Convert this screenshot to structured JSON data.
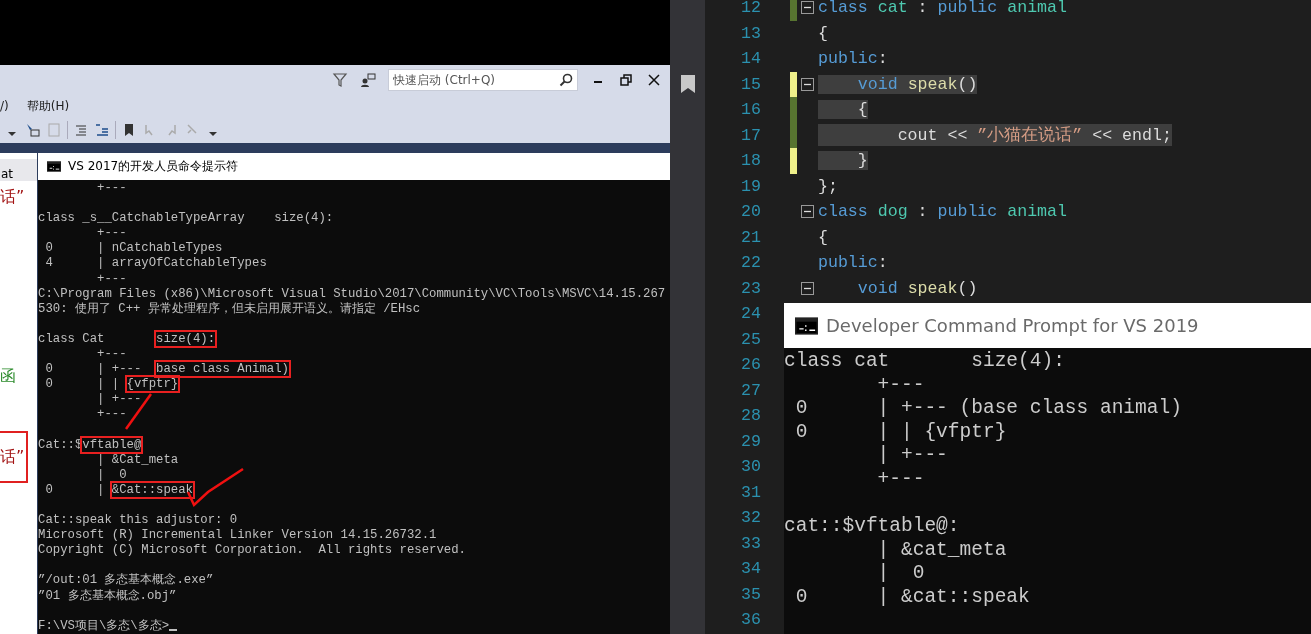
{
  "ide_window": {
    "quick_launch": {
      "placeholder": "快速启动 (Ctrl+Q)"
    },
    "menu": [
      {
        "label": "/)"
      },
      {
        "label": "帮助(H)"
      }
    ]
  },
  "background_editor": {
    "fragments": [
      {
        "text": "at",
        "kind": "tab"
      },
      {
        "text": "话”",
        "kind": "string"
      },
      {
        "text": "函",
        "kind": "comment"
      },
      {
        "text": "话”",
        "kind": "boxed"
      }
    ]
  },
  "console_2017": {
    "title": "VS 2017的开发人员命令提示符",
    "lines": [
      {
        "kind": "text",
        "text": "        +---"
      },
      {
        "kind": "blank"
      },
      {
        "kind": "text",
        "text": "class _s__CatchableTypeArray    size(4):"
      },
      {
        "kind": "text",
        "text": "        +---"
      },
      {
        "kind": "text",
        "text": " 0      | nCatchableTypes"
      },
      {
        "kind": "text",
        "text": " 4      | arrayOfCatchableTypes"
      },
      {
        "kind": "text",
        "text": "        +---"
      },
      {
        "kind": "text",
        "text": "C:\\Program Files (x86)\\Microsoft Visual Studio\\2017\\Community\\VC\\Tools\\MSVC\\14.15.267"
      },
      {
        "kind": "text",
        "text": "530: 使用了 C++ 异常处理程序，但未启用展开语义。请指定 /EHsc"
      },
      {
        "kind": "blank"
      },
      {
        "kind": "marked",
        "segments": [
          {
            "text": "class Cat       ",
            "boxed": false
          },
          {
            "text": "size(4):",
            "boxed": true
          }
        ]
      },
      {
        "kind": "text",
        "text": "        +---"
      },
      {
        "kind": "marked",
        "segments": [
          {
            "text": " 0      | +---  ",
            "boxed": false
          },
          {
            "text": "base class Animal)",
            "boxed": true
          }
        ]
      },
      {
        "kind": "marked",
        "segments": [
          {
            "text": " 0      | | ",
            "boxed": false
          },
          {
            "text": "{vfptr}",
            "boxed": true
          }
        ]
      },
      {
        "kind": "text",
        "text": "        | +---"
      },
      {
        "kind": "text",
        "text": "        +---"
      },
      {
        "kind": "blank"
      },
      {
        "kind": "marked",
        "segments": [
          {
            "text": "Cat::$",
            "boxed": false
          },
          {
            "text": "vftable@",
            "boxed": true
          }
        ]
      },
      {
        "kind": "text",
        "text": "        | &Cat_meta"
      },
      {
        "kind": "text",
        "text": "        |  0"
      },
      {
        "kind": "marked",
        "segments": [
          {
            "text": " 0      | ",
            "boxed": false
          },
          {
            "text": "&Cat::speak",
            "boxed": true
          }
        ]
      },
      {
        "kind": "blank"
      },
      {
        "kind": "text",
        "text": "Cat::speak this adjustor: 0"
      },
      {
        "kind": "text",
        "text": "Microsoft (R) Incremental Linker Version 14.15.26732.1"
      },
      {
        "kind": "text",
        "text": "Copyright (C) Microsoft Corporation.  All rights reserved."
      },
      {
        "kind": "blank"
      },
      {
        "kind": "text",
        "text": "”/out:01 多态基本概念.exe”"
      },
      {
        "kind": "text",
        "text": "”01 多态基本概念.obj”"
      },
      {
        "kind": "blank"
      },
      {
        "kind": "prompt",
        "text": "F:\\VS项目\\多态\\多态>"
      }
    ]
  },
  "code_editor": {
    "rows": [
      {
        "number": "12",
        "color": "#577430",
        "foldable": true,
        "highlighted": false,
        "bookmarked": false,
        "tokens": [
          {
            "text": "class",
            "kind": "keyword"
          },
          {
            "text": " cat",
            "kind": "type"
          },
          {
            "text": " : ",
            "kind": "plain"
          },
          {
            "text": "public",
            "kind": "keyword"
          },
          {
            "text": " animal",
            "kind": "type"
          }
        ]
      },
      {
        "number": "13",
        "foldable": false,
        "highlighted": false,
        "bookmarked": false,
        "tokens": [
          {
            "text": "{",
            "kind": "plain"
          }
        ]
      },
      {
        "number": "14",
        "foldable": false,
        "highlighted": false,
        "bookmarked": false,
        "tokens": [
          {
            "text": "public",
            "kind": "keyword"
          },
          {
            "text": ":",
            "kind": "plain"
          }
        ]
      },
      {
        "number": "15",
        "color": "#eff08a",
        "foldable": true,
        "highlighted": true,
        "bookmarked": true,
        "tokens": [
          {
            "text": "    void",
            "kind": "keyword"
          },
          {
            "text": " speak",
            "kind": "function"
          },
          {
            "text": "()",
            "kind": "plain"
          }
        ]
      },
      {
        "number": "16",
        "color": "#577430",
        "foldable": false,
        "highlighted": true,
        "bookmarked": false,
        "tokens": [
          {
            "text": "    {",
            "kind": "plain"
          }
        ]
      },
      {
        "number": "17",
        "color": "#577430",
        "foldable": false,
        "highlighted": true,
        "bookmarked": false,
        "tokens": [
          {
            "text": "        cout << ",
            "kind": "plain"
          },
          {
            "text": "”小猫在说话”",
            "kind": "string"
          },
          {
            "text": " << endl;",
            "kind": "plain"
          }
        ]
      },
      {
        "number": "18",
        "color": "#eff08a",
        "foldable": false,
        "highlighted": true,
        "bookmarked": false,
        "tokens": [
          {
            "text": "    }",
            "kind": "plain"
          }
        ]
      },
      {
        "number": "19",
        "foldable": false,
        "highlighted": false,
        "bookmarked": false,
        "tokens": [
          {
            "text": "};",
            "kind": "plain"
          }
        ]
      },
      {
        "number": "20",
        "foldable": true,
        "highlighted": false,
        "bookmarked": false,
        "tokens": [
          {
            "text": "class",
            "kind": "keyword"
          },
          {
            "text": " dog",
            "kind": "type"
          },
          {
            "text": " : ",
            "kind": "plain"
          },
          {
            "text": "public",
            "kind": "keyword"
          },
          {
            "text": " animal",
            "kind": "type"
          }
        ]
      },
      {
        "number": "21",
        "foldable": false,
        "highlighted": false,
        "bookmarked": false,
        "tokens": [
          {
            "text": "{",
            "kind": "plain"
          }
        ]
      },
      {
        "number": "22",
        "foldable": false,
        "highlighted": false,
        "bookmarked": false,
        "tokens": [
          {
            "text": "public",
            "kind": "keyword"
          },
          {
            "text": ":",
            "kind": "plain"
          }
        ]
      },
      {
        "number": "23",
        "foldable": true,
        "highlighted": false,
        "bookmarked": false,
        "tokens": [
          {
            "text": "    void",
            "kind": "keyword"
          },
          {
            "text": " speak",
            "kind": "function"
          },
          {
            "text": "()",
            "kind": "plain"
          }
        ]
      },
      {
        "number": "24"
      },
      {
        "number": "25"
      },
      {
        "number": "26"
      },
      {
        "number": "27"
      },
      {
        "number": "28"
      },
      {
        "number": "29"
      },
      {
        "number": "30"
      },
      {
        "number": "31"
      },
      {
        "number": "32"
      },
      {
        "number": "33"
      },
      {
        "number": "34"
      },
      {
        "number": "35"
      },
      {
        "number": "36"
      }
    ]
  },
  "console_2019": {
    "title": "Developer Command Prompt for VS 2019",
    "lines": [
      {
        "kind": "text",
        "text": "class cat       size(4):"
      },
      {
        "kind": "text",
        "text": "        +---"
      },
      {
        "kind": "text",
        "text": " 0      | +--- (base class animal)"
      },
      {
        "kind": "text",
        "text": " 0      | | {vfptr}"
      },
      {
        "kind": "text",
        "text": "        | +---"
      },
      {
        "kind": "text",
        "text": "        +---"
      },
      {
        "kind": "blank"
      },
      {
        "kind": "text",
        "text": "cat::$vftable@:"
      },
      {
        "kind": "text",
        "text": "        | &cat_meta"
      },
      {
        "kind": "text",
        "text": "        |  0"
      },
      {
        "kind": "text",
        "text": " 0      | &cat::speak"
      }
    ]
  }
}
